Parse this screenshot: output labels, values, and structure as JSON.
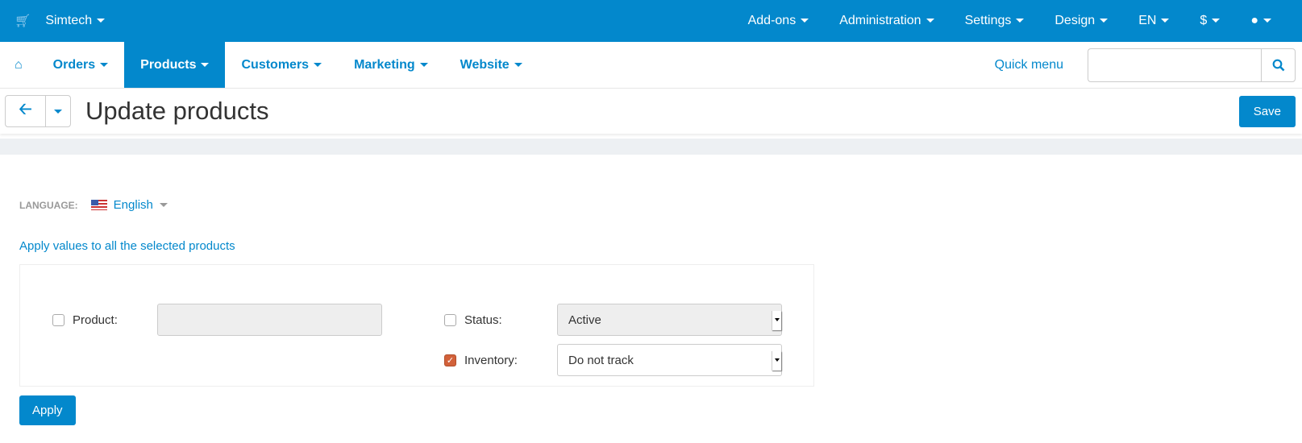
{
  "topbar": {
    "store": "Simtech",
    "items": [
      "Add-ons",
      "Administration",
      "Settings",
      "Design",
      "EN",
      "$"
    ]
  },
  "nav": {
    "items": [
      "Orders",
      "Products",
      "Customers",
      "Marketing",
      "Website"
    ],
    "active": "Products",
    "quick_menu": "Quick menu",
    "search_placeholder": ""
  },
  "header": {
    "title": "Update products",
    "save": "Save"
  },
  "language": {
    "label": "LANGUAGE:",
    "value": "English"
  },
  "form": {
    "title": "Apply values to all the selected products",
    "product": {
      "label": "Product:",
      "value": "",
      "checked": false
    },
    "status": {
      "label": "Status:",
      "value": "Active",
      "checked": false
    },
    "inventory": {
      "label": "Inventory:",
      "value": "Do not track",
      "checked": true
    },
    "apply": "Apply"
  },
  "colors": {
    "accent": "#0388cc",
    "checkbox_checked": "#d2613a"
  }
}
